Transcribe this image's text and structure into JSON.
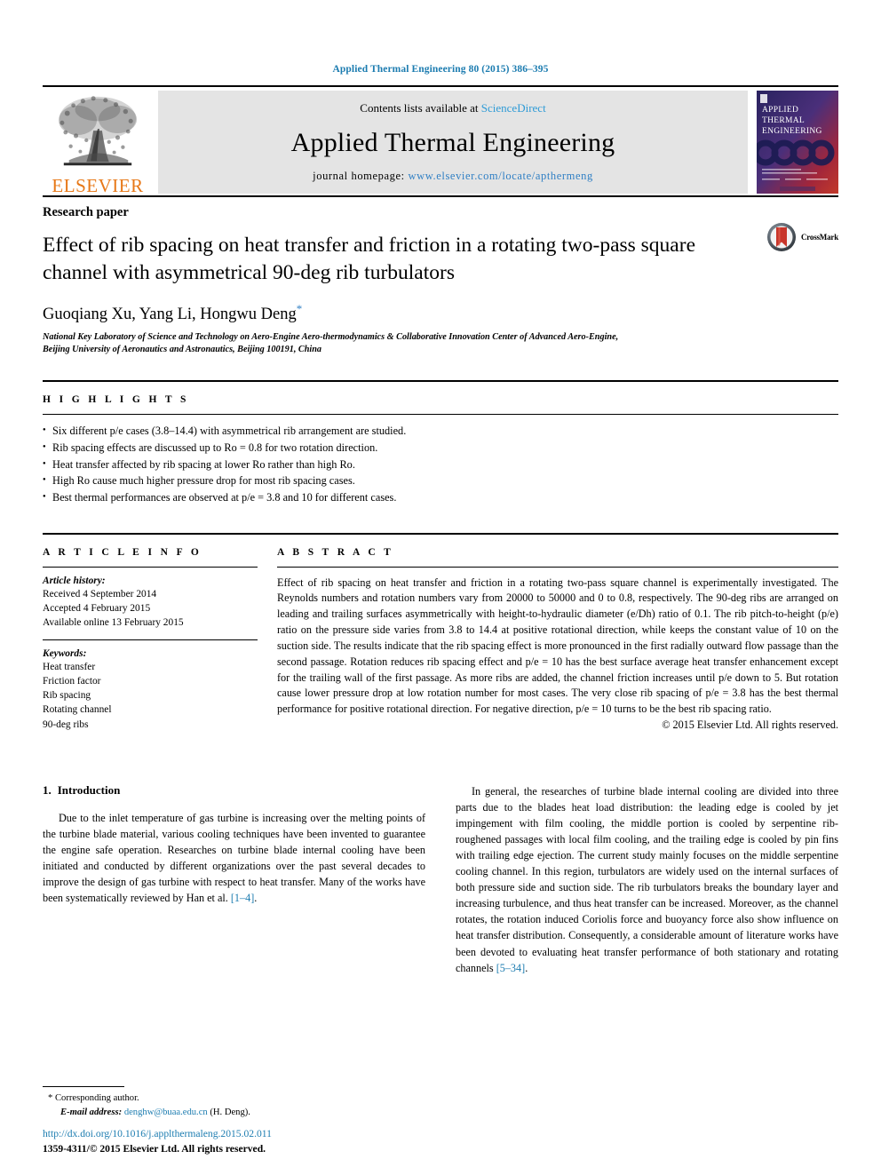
{
  "running_head": "Applied Thermal Engineering 80 (2015) 386–395",
  "masthead": {
    "publisher_name": "ELSEVIER",
    "contents_prefix": "Contents lists available at ",
    "contents_link": "ScienceDirect",
    "journal_title": "Applied Thermal Engineering",
    "homepage_prefix": "journal homepage: ",
    "homepage_url": "www.elsevier.com/locate/apthermeng",
    "cover": {
      "line1": "APPLIED",
      "line2": "THERMAL",
      "line3": "ENGINEERING"
    }
  },
  "article": {
    "type_label": "Research paper",
    "title": "Effect of rib spacing on heat transfer and friction in a rotating two-pass square channel with asymmetrical 90-deg rib turbulators",
    "crossmark_label": "CrossMark",
    "authors": "Guoqiang Xu, Yang Li, Hongwu Deng",
    "corresponding_marker": "*",
    "affiliation_line1": "National Key Laboratory of Science and Technology on Aero-Engine Aero-thermodynamics & Collaborative Innovation Center of Advanced Aero-Engine,",
    "affiliation_line2": "Beijing University of Aeronautics and Astronautics, Beijing 100191, China"
  },
  "highlights": {
    "heading": "H I G H L I G H T S",
    "items": [
      "Six different p/e cases (3.8–14.4) with asymmetrical rib arrangement are studied.",
      "Rib spacing effects are discussed up to Ro = 0.8 for two rotation direction.",
      "Heat transfer affected by rib spacing at lower Ro rather than high Ro.",
      "High Ro cause much higher pressure drop for most rib spacing cases.",
      "Best thermal performances are observed at p/e = 3.8 and 10 for different cases."
    ]
  },
  "article_info": {
    "heading": "A R T I C L E    I N F O",
    "history_label": "Article history:",
    "history": [
      "Received 4 September 2014",
      "Accepted 4 February 2015",
      "Available online 13 February 2015"
    ],
    "keywords_label": "Keywords:",
    "keywords": [
      "Heat transfer",
      "Friction factor",
      "Rib spacing",
      "Rotating channel",
      "90-deg ribs"
    ]
  },
  "abstract": {
    "heading": "A B S T R A C T",
    "text": "Effect of rib spacing on heat transfer and friction in a rotating two-pass square channel is experimentally investigated. The Reynolds numbers and rotation numbers vary from 20000 to 50000 and 0 to 0.8, respectively. The 90-deg ribs are arranged on leading and trailing surfaces asymmetrically with height-to-hydraulic diameter (e/Dh) ratio of 0.1. The rib pitch-to-height (p/e) ratio on the pressure side varies from 3.8 to 14.4 at positive rotational direction, while keeps the constant value of 10 on the suction side. The results indicate that the rib spacing effect is more pronounced in the first radially outward flow passage than the second passage. Rotation reduces rib spacing effect and p/e = 10 has the best surface average heat transfer enhancement except for the trailing wall of the first passage. As more ribs are added, the channel friction increases until p/e down to 5. But rotation cause lower pressure drop at low rotation number for most cases. The very close rib spacing of p/e = 3.8 has the best thermal performance for positive rotational direction. For negative direction, p/e = 10 turns to be the best rib spacing ratio.",
    "copyright": "© 2015 Elsevier Ltd. All rights reserved."
  },
  "body": {
    "section_number": "1.",
    "section_title": "Introduction",
    "left_paragraph_a": "Due to the inlet temperature of gas turbine is increasing over the melting points of the turbine blade material, various cooling techniques have been invented to guarantee the engine safe operation. Researches on turbine blade internal cooling have been initiated and conducted by different organizations over the past several decades to improve the design of gas turbine with respect to heat transfer. Many of the works have been systematically reviewed by Han et al. ",
    "left_paragraph_a_ref": "[1–4]",
    "left_paragraph_a_end": ".",
    "right_paragraph_a": "In general, the researches of turbine blade internal cooling are divided into three parts due to the blades heat load distribution: the leading edge is cooled by jet impingement with film cooling, the middle portion is cooled by serpentine rib-roughened passages with local film cooling, and the trailing edge is cooled by pin fins with trailing edge ejection. The current study mainly focuses on the middle serpentine cooling channel. In this region, turbulators are widely used on the internal surfaces of both pressure side and suction side. The rib turbulators breaks the boundary layer and increasing turbulence, and thus heat transfer can be increased. Moreover, as the channel rotates, the rotation induced Coriolis force and buoyancy force also show influence on heat transfer distribution. Consequently, a considerable amount of literature works have been devoted to evaluating heat transfer performance of both stationary and rotating channels ",
    "right_paragraph_a_ref": "[5–34]",
    "right_paragraph_a_end": "."
  },
  "footnote": {
    "corresponding_marker": "*",
    "corresponding_text": "Corresponding author.",
    "email_label": "E-mail address:",
    "email": "denghw@buaa.edu.cn",
    "email_suffix": "(H. Deng).",
    "doi": "http://dx.doi.org/10.1016/j.applthermaleng.2015.02.011",
    "issn": "1359-4311/© 2015 Elsevier Ltd. All rights reserved."
  },
  "colors": {
    "link_blue": "#1c7cb0",
    "sciencedirect_blue": "#2f9bd6",
    "elsevier_orange": "#e77817",
    "masthead_gray": "#e4e4e4"
  }
}
